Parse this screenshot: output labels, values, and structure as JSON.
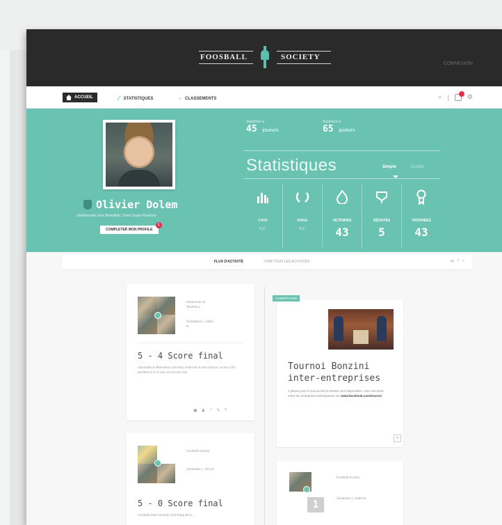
{
  "header": {
    "logo_left": "FOOSBALL",
    "logo_right": "SOCIETY",
    "connect_label": "CONNEXION"
  },
  "nav": {
    "home": "ACCUEIL",
    "stats": "STATISTIQUES",
    "rankings": "CLASSEMENTS",
    "notification_count": "2"
  },
  "profile": {
    "name": "Olivier Dolem",
    "subtitle": "Gestionnaire chez Brandlink  |  Team Super Rouleurs",
    "complete_button": "COMPLETER MON PROFILE",
    "complete_badge": "1"
  },
  "ranking": {
    "left_label": "Supérieur à",
    "left_value": "45",
    "left_unit": "joueurs",
    "right_label": "Supérieur à",
    "right_value": "65",
    "right_unit": "joueurs"
  },
  "stats": {
    "title": "Statistiques",
    "toggle_active": "Simple",
    "toggle_inactive": "Double",
    "tiles": [
      {
        "label": "CAVE",
        "value": "N.C.",
        "icon": "bar-chart-icon"
      },
      {
        "label": "RANG",
        "value": "N.C.",
        "icon": "laurel-icon"
      },
      {
        "label": "VICTOIRES",
        "value": "43",
        "icon": "flame-icon"
      },
      {
        "label": "DÉFAITES",
        "value": "5",
        "icon": "ribbon-icon"
      },
      {
        "label": "TROPHÉES",
        "value": "43",
        "icon": "medal-icon"
      }
    ]
  },
  "feed": {
    "tab_active": "FLUX D'ACTIVITÉ",
    "tab_inactive": "VOIR TOUS LES ACTIVITÉS",
    "share": "f"
  },
  "cards": {
    "match1": {
      "team_a": "Olowomaro & Thomas L.",
      "team_b": "Grandama L. Adam R.",
      "title": "5 - 4  Score final",
      "text": "Alexander & Rhemanus ont battu Ambroise & Alex Dulcas. Le jeu a fini pendant la 8. le tour est encore vive."
    },
    "event": {
      "tag": "COMPÉTITION",
      "title_1": "Tournoi Bonzini",
      "title_2": "inter-entreprises",
      "text": "4 places pour le tournoi de la rentrée sont disponibles. Une rencontre entre les entreprises participantes sur",
      "link": "www.facebook.com/tournoi"
    },
    "match2": {
      "team_a": "Foosball Society",
      "team_b": "Alexander L. Alex R.",
      "title": "5 - 0  Score final",
      "text": "Foosball Team Society First Rapp 50 a..."
    },
    "rank_card": {
      "label_a": "Foosball Society",
      "label_b": "Alexander L. Adam B.",
      "rank": "1"
    }
  }
}
